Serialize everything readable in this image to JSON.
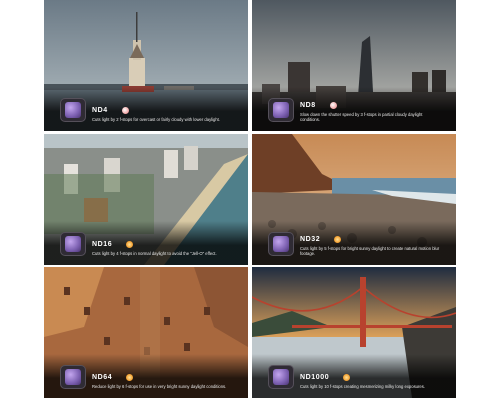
{
  "panels": [
    {
      "label": "ND4",
      "icon": "cloud-sun-icon",
      "desc": "Cuts light by 2 f-stops for overcast or fairly cloudy with lower daylight."
    },
    {
      "label": "ND8",
      "icon": "cloud-sun-icon",
      "desc": "Slow down the shutter speed by 3 f-stops in partial cloudy daylight conditions."
    },
    {
      "label": "ND16",
      "icon": "sun-icon",
      "desc": "Cuts light by 4 f-stops in normal daylight to avoid the \"Jell-O\" effect."
    },
    {
      "label": "ND32",
      "icon": "sun-icon",
      "desc": "Cuts light by 5 f-stops for bright sunny daylight to create natural motion blur footage."
    },
    {
      "label": "ND64",
      "icon": "sun-icon",
      "desc": "Reduce light by 6 f-stops for use in very bright sunny daylight conditions."
    },
    {
      "label": "ND1000",
      "icon": "sun-icon",
      "desc": "Cuts light by 10 f-stops creating mesmerizing milky long exposures."
    }
  ]
}
